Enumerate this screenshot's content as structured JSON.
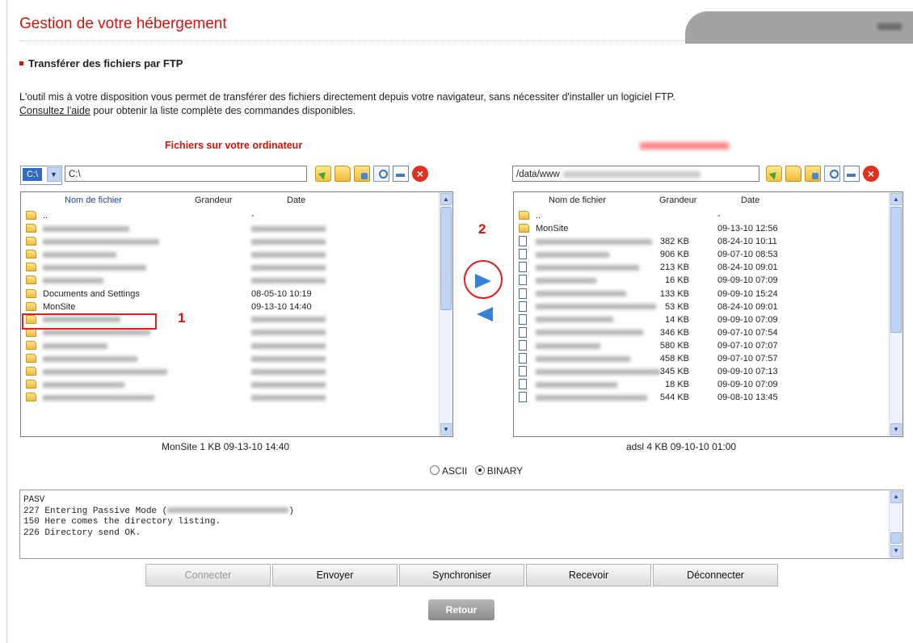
{
  "header": {
    "title": "Gestion de votre hébergement",
    "user_blurred": "abcdfh"
  },
  "section_title": "Transférer des fichiers par FTP",
  "intro": {
    "line1": "L'outil mis à votre disposition vous permet de transférer des fichiers directement depuis votre navigateur, sans nécessiter d'installer un logiciel FTP.",
    "link": "Consultez l'aide",
    "line2_rest": " pour obtenir la liste complète des commandes disponibles."
  },
  "local": {
    "title": "Fichiers sur votre ordinateur",
    "drive": "C:\\",
    "path": "C:\\",
    "columns": [
      "Nom de fichier",
      "Grandeur",
      "Date"
    ],
    "rows": [
      {
        "name": "..",
        "size": "",
        "date": "-",
        "blur": false
      },
      {
        "name": "",
        "size": "",
        "date": "",
        "blur": true
      },
      {
        "name": "",
        "size": "",
        "date": "",
        "blur": true
      },
      {
        "name": "",
        "size": "",
        "date": "",
        "blur": true
      },
      {
        "name": "",
        "size": "",
        "date": "",
        "blur": true
      },
      {
        "name": "",
        "size": "",
        "date": "",
        "blur": true
      },
      {
        "name": "Documents and Settings",
        "size": "",
        "date": "08-05-10 10:19",
        "blur": false
      },
      {
        "name": "MonSite",
        "size": "",
        "date": "09-13-10 14:40",
        "blur": false
      },
      {
        "name": "",
        "size": "",
        "date": "",
        "blur": true
      },
      {
        "name": "",
        "size": "",
        "date": "",
        "blur": true
      },
      {
        "name": "",
        "size": "",
        "date": "",
        "blur": true
      },
      {
        "name": "",
        "size": "",
        "date": "",
        "blur": true
      },
      {
        "name": "",
        "size": "",
        "date": "",
        "blur": true
      },
      {
        "name": "",
        "size": "",
        "date": "",
        "blur": true
      },
      {
        "name": "",
        "size": "",
        "date": "",
        "blur": true
      }
    ],
    "status": "MonSite   1 KB   09-13-10 14:40"
  },
  "remote": {
    "title_blurred": "192.168.128.215",
    "path": "/data/www",
    "columns": [
      "Nom de fichier",
      "Grandeur",
      "Date"
    ],
    "rows": [
      {
        "type": "folder",
        "name": "..",
        "size": "",
        "date": "-",
        "blur": false
      },
      {
        "type": "folder",
        "name": "MonSite",
        "size": "",
        "date": "09-13-10 12:56",
        "blur": false
      },
      {
        "type": "file",
        "name": "",
        "size": "382 KB",
        "date": "08-24-10 10:11",
        "blur": true
      },
      {
        "type": "file",
        "name": "",
        "size": "906 KB",
        "date": "09-07-10 08:53",
        "blur": true
      },
      {
        "type": "file",
        "name": "",
        "size": "213 KB",
        "date": "08-24-10 09:01",
        "blur": true
      },
      {
        "type": "file",
        "name": "",
        "size": "16 KB",
        "date": "09-09-10 07:09",
        "blur": true
      },
      {
        "type": "file",
        "name": "",
        "size": "133 KB",
        "date": "09-09-10 15:24",
        "blur": true
      },
      {
        "type": "file",
        "name": "",
        "size": "53 KB",
        "date": "08-24-10 09:01",
        "blur": true
      },
      {
        "type": "file",
        "name": "",
        "size": "14 KB",
        "date": "09-09-10 07:09",
        "blur": true
      },
      {
        "type": "file",
        "name": "",
        "size": "346 KB",
        "date": "09-07-10 07:54",
        "blur": true
      },
      {
        "type": "file",
        "name": "",
        "size": "580 KB",
        "date": "09-07-10 07:07",
        "blur": true
      },
      {
        "type": "file",
        "name": "",
        "size": "458 KB",
        "date": "09-07-10 07:57",
        "blur": true
      },
      {
        "type": "file",
        "name": "",
        "size": "345 KB",
        "date": "09-09-10 07:13",
        "blur": true
      },
      {
        "type": "file",
        "name": "",
        "size": "18 KB",
        "date": "09-09-10 07:09",
        "blur": true
      },
      {
        "type": "file",
        "name": "",
        "size": "544 KB",
        "date": "09-08-10 13:45",
        "blur": true
      }
    ],
    "status": "adsl   4 KB   09-10-10 01:00"
  },
  "annotations": {
    "step1": "1",
    "step2": "2"
  },
  "mode": {
    "ascii": "ASCII",
    "binary": "BINARY",
    "selected": "BINARY"
  },
  "log": {
    "lines": [
      "PASV",
      "227 Entering Passive Mode (",
      "150 Here comes the directory listing.",
      "226 Directory send OK."
    ],
    "line2_end": ")"
  },
  "buttons": {
    "connect": "Connecter",
    "send": "Envoyer",
    "sync": "Synchroniser",
    "receive": "Recevoir",
    "disconnect": "Déconnecter",
    "back": "Retour"
  },
  "colors": {
    "accent": "#d4140c",
    "arrow": "#3583d6"
  }
}
